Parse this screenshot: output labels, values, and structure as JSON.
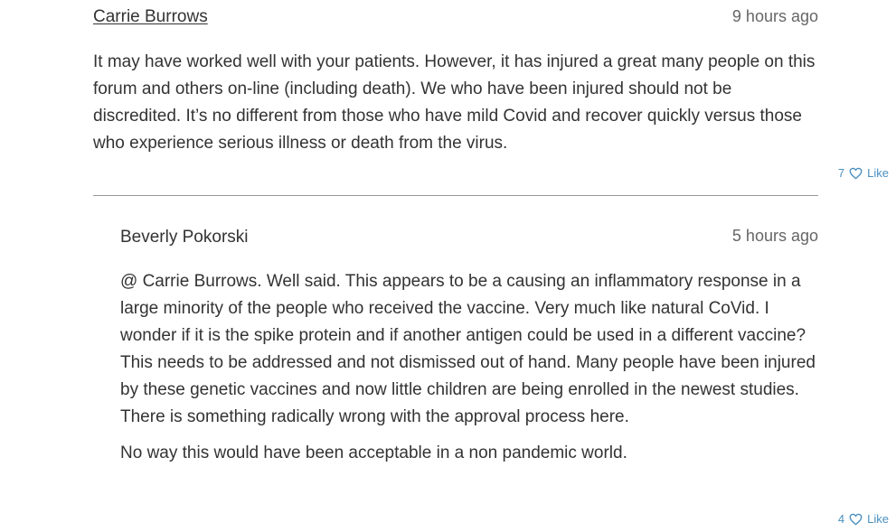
{
  "comments": [
    {
      "author": "Carrie Burrows",
      "timestamp": "9 hours ago",
      "paragraphs": [
        "It may have worked well with your patients. However, it has injured a great many people on this forum and others on-line (including death). We who have been injured should not be discredited. It’s no different from those who have mild Covid and recover quickly versus those who experience serious illness or death from the virus."
      ],
      "likes": "7",
      "like_label": "Like"
    },
    {
      "author": "Beverly Pokorski",
      "timestamp": "5 hours ago",
      "paragraphs": [
        "@ Carrie Burrows. Well said. This appears to be a causing an inflammatory response in a large minority of the people who received the vaccine. Very much like natural CoVid. I wonder if it is the spike protein and if another antigen could be used in a different vaccine? This needs to be addressed and not dismissed out of hand. Many people have been injured by these genetic vaccines and now little children are being enrolled in the newest studies. There is something radically wrong with the approval process here.",
        "No way this would have been acceptable in a non pandemic world."
      ],
      "likes": "4",
      "like_label": "Like"
    }
  ],
  "colors": {
    "text": "#333333",
    "timestamp": "#666666",
    "like_accent": "#4a8fc0",
    "divider": "#999999"
  },
  "icons": {
    "like": "heart-outline-icon"
  }
}
